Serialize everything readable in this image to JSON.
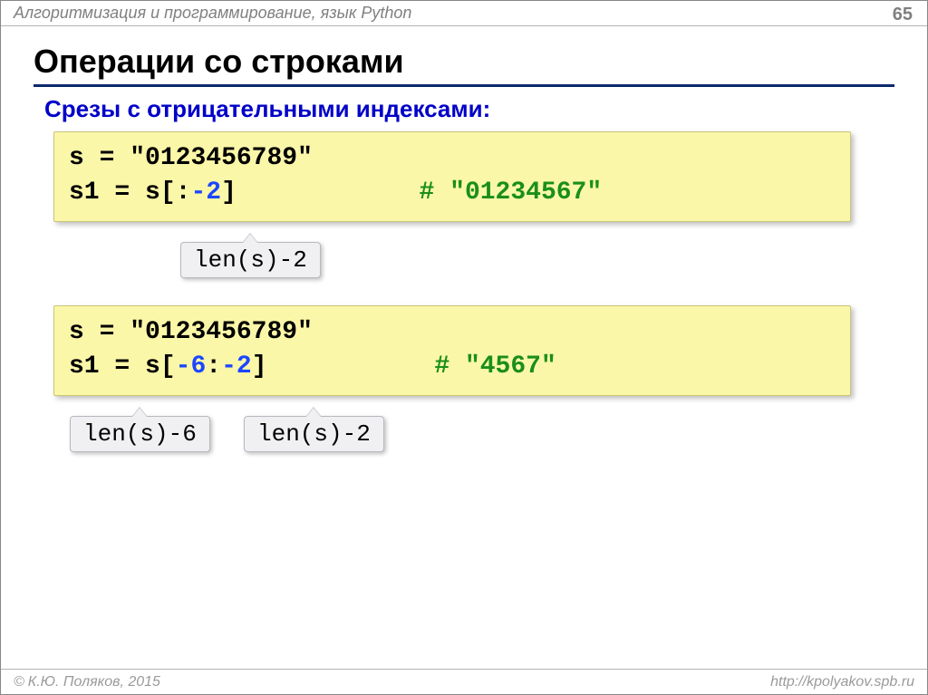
{
  "topbar": {
    "title": "Алгоритмизация и программирование, язык Python"
  },
  "pagenum": "65",
  "heading": "Операции со строками",
  "subheading": "Срезы с отрицательными индексами:",
  "code1": {
    "line1_lhs": "s",
    "line1_eq": "=",
    "line1_rhs": "\"0123456789\"",
    "line2_lhs": "s1",
    "line2_eq": "=",
    "line2_pre": "s[:",
    "line2_neg": "-2",
    "line2_post": "]",
    "line2_comment": "# \"01234567\""
  },
  "callout1": "len(s)-2",
  "code2": {
    "line1_lhs": "s",
    "line1_eq": "=",
    "line1_rhs": "\"0123456789\"",
    "line2_lhs": "s1",
    "line2_eq": "=",
    "line2_pre": "s[",
    "line2_neg1": "-6",
    "line2_mid": ":",
    "line2_neg2": "-2",
    "line2_post": "]",
    "line2_comment": "# \"4567\""
  },
  "callout2": "len(s)-6",
  "callout3": "len(s)-2",
  "footer": {
    "copyright_symbol": "©",
    "author": "К.Ю. Поляков, 2015",
    "url": "http://kpolyakov.spb.ru"
  }
}
